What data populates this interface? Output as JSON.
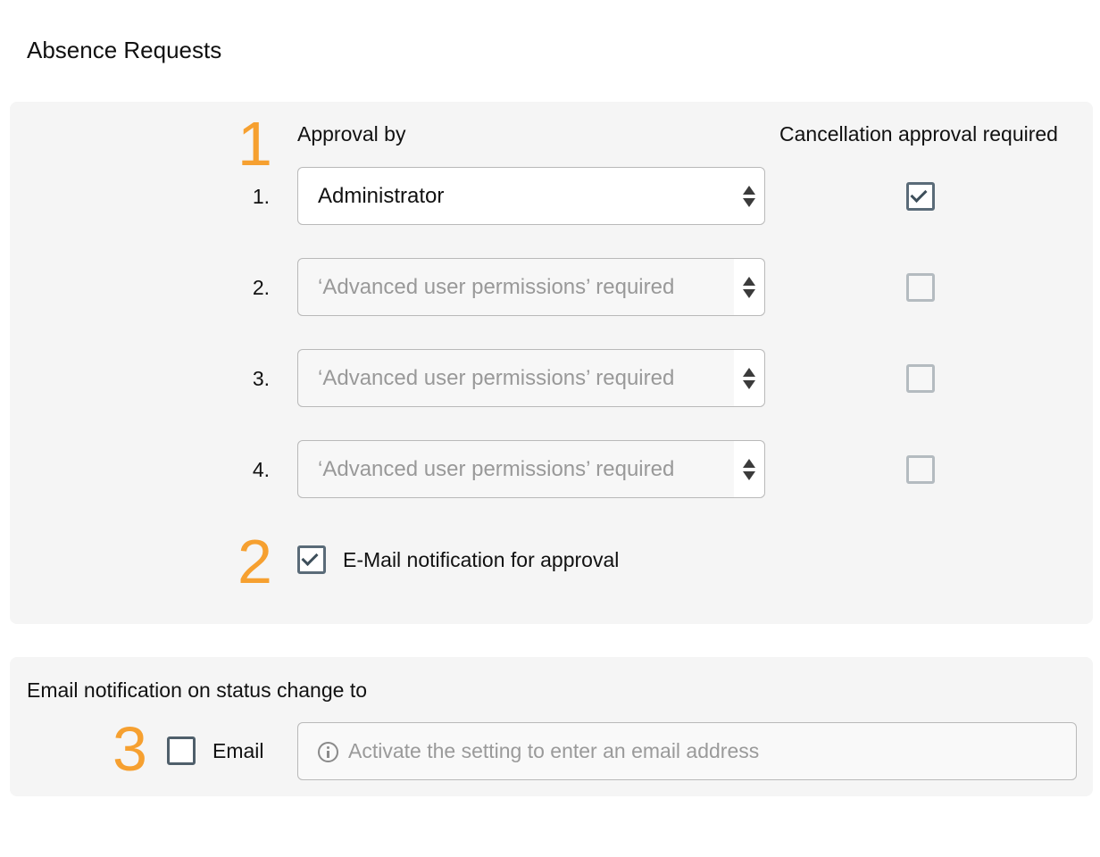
{
  "page": {
    "title": "Absence Requests"
  },
  "approval_section": {
    "callout": "1",
    "header_approval_by": "Approval by",
    "header_cancellation": "Cancellation approval required",
    "rows": [
      {
        "number": "1.",
        "value": "Administrator",
        "enabled": true,
        "cancellation_checked": true
      },
      {
        "number": "2.",
        "value": "‘Advanced user permissions’ required",
        "enabled": false,
        "cancellation_checked": false
      },
      {
        "number": "3.",
        "value": "‘Advanced user permissions’ required",
        "enabled": false,
        "cancellation_checked": false
      },
      {
        "number": "4.",
        "value": "‘Advanced user permissions’ required",
        "enabled": false,
        "cancellation_checked": false
      }
    ],
    "email_notification": {
      "callout": "2",
      "label": "E-Mail notification for approval",
      "checked": true
    }
  },
  "status_section": {
    "title": "Email notification on status change to",
    "callout": "3",
    "email_checkbox": {
      "label": "Email",
      "checked": false
    },
    "email_input": {
      "placeholder": "Activate the setting to enter an email address",
      "value": ""
    }
  },
  "colors": {
    "callout": "#f6a030",
    "panel_bg": "#f5f5f5",
    "checkbox_border": "#5a6b78"
  }
}
